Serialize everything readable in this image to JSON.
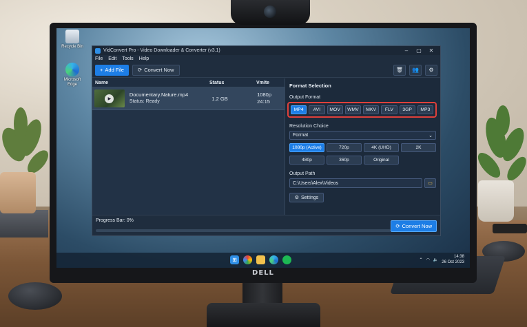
{
  "desktop": {
    "icons": [
      {
        "label": "Recycle Bin"
      },
      {
        "label": "Microsoft Edge"
      }
    ]
  },
  "window": {
    "title": "VidConvert Pro - Video Downloader & Converter (v3.1)",
    "controls": {
      "minimize": "–",
      "maximize": "▢",
      "close": "✕"
    }
  },
  "menu": [
    "File",
    "Edit",
    "Tools",
    "Help"
  ],
  "toolbar": {
    "add_file": "Add File",
    "convert_now": "Convert Now",
    "icons": [
      "trash-icon",
      "users-icon",
      "gear-icon"
    ]
  },
  "file_table": {
    "columns": [
      "Name",
      "Status",
      "Vmite"
    ],
    "rows": [
      {
        "name": "Documentary.Nature.mp4",
        "status": "Status: Ready",
        "size": "1.2 GB",
        "resolution": "1080p",
        "duration": "24:15"
      }
    ]
  },
  "format_selection": {
    "title": "Format Selection",
    "output_format_label": "Output Format",
    "formats": [
      "MP4",
      "AVI",
      "MOV",
      "WMV",
      "MKV",
      "FLV",
      "3GP",
      "MP3"
    ],
    "selected_format": "MP4",
    "resolution_label": "Resolution Choice",
    "resolution_select": "Format",
    "resolutions": [
      "1080p (Active)",
      "720p",
      "4K (UHD)",
      "2K",
      "480p",
      "360p",
      "Original"
    ],
    "selected_resolution": "1080p (Active)",
    "output_path_label": "Output Path",
    "output_path": "C:\\Users\\Alex\\Videos",
    "settings_label": "Settings"
  },
  "footer": {
    "progress_label": "Progress Bar: 0%",
    "progress": 0,
    "convert_now": "Convert Now"
  },
  "taskbar": {
    "time": "14:38",
    "date": "26 Oct 2023"
  },
  "monitor": {
    "brand": "DELL"
  },
  "colors": {
    "accent": "#1d7ee6",
    "highlight_border": "#e0403b",
    "window_bg": "#1f2d3e"
  }
}
